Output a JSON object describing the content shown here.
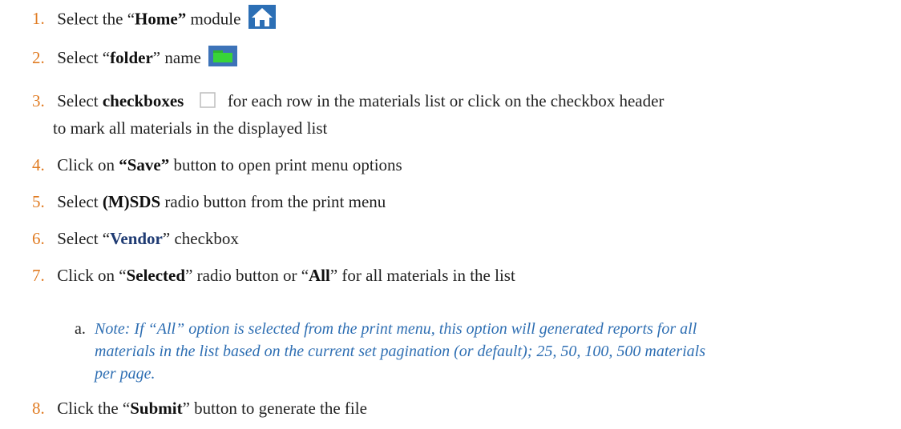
{
  "steps": [
    {
      "num": "1.",
      "pre": "Select the “",
      "b": "Home”",
      "post": " module",
      "icon": "home-icon"
    },
    {
      "num": "2.",
      "pre": "Select “",
      "b": "folder",
      "post": "” name",
      "icon": "folder-icon"
    },
    {
      "num": "3.",
      "pre": "Select ",
      "b": "checkboxes",
      "post": " for each row in the materials list or click on the checkbox header",
      "line2": "to mark all materials in the displayed list",
      "icon": "checkbox-icon"
    },
    {
      "num": "4.",
      "pre": "Click on ",
      "b": "“Save”",
      "post": " button to open print menu options"
    },
    {
      "num": "5.",
      "pre": "Select ",
      "b": "(M)SDS",
      "post": " radio button from the print menu"
    },
    {
      "num": "6.",
      "pre": "Select “",
      "b": "Vendor",
      "post": "” checkbox"
    },
    {
      "num": "7.",
      "pre": "Click on “",
      "b": "Selected",
      "mid": "” radio button or “",
      "b2": "All",
      "post": "” for all materials in the list"
    },
    {
      "num": "8.",
      "pre": "Click the “",
      "b": "Submit",
      "post": "” button to generate the file"
    }
  ],
  "note": {
    "label": "a.",
    "line1": "Note: If “All” option is selected from the print menu, this option will generated reports for all",
    "line2": "materials in the list based on the current set pagination (or default); 25, 50, 100, 500 materials",
    "line3": "per page."
  },
  "colors": {
    "number": "#e07b22",
    "note": "#2f6fb3",
    "vendor": "#1f3b73"
  }
}
